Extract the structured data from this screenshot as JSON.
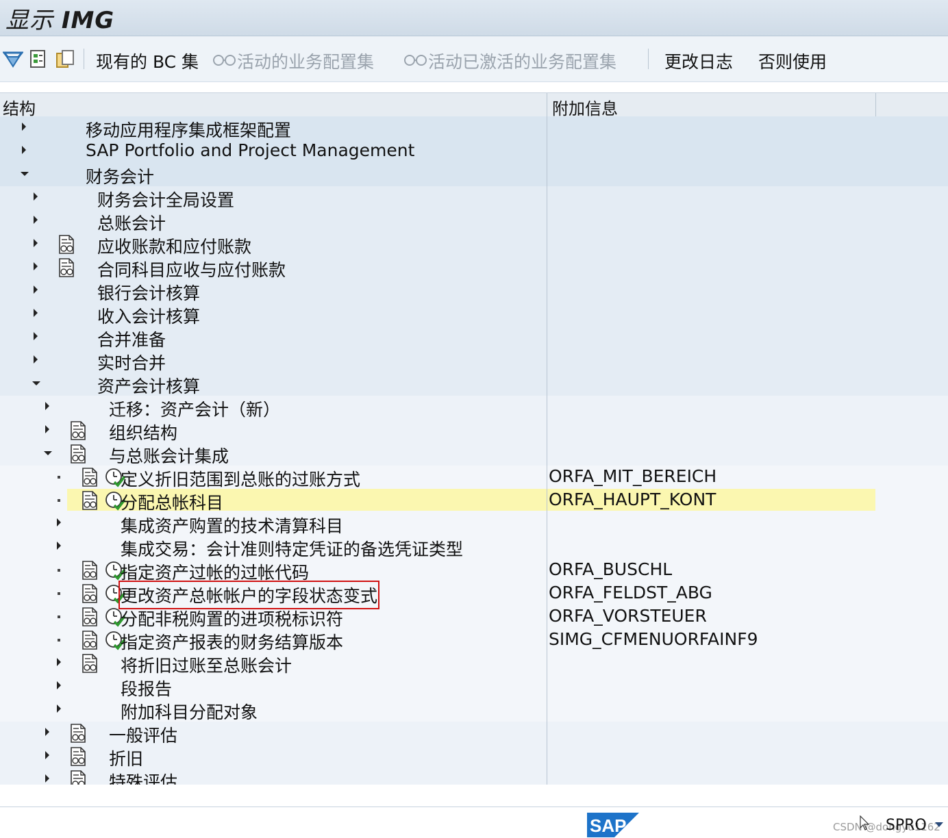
{
  "window": {
    "title_prefix": "显示 ",
    "title_bold": "IMG"
  },
  "toolbar": {
    "icons": [
      "expand-all-icon",
      "execute-icon",
      "copy-icon"
    ],
    "btn_bc": "现有的 BC 集",
    "btn_active": "活动的业务配置集",
    "btn_activated": "活动已激活的业务配置集",
    "btn_log": "更改日志",
    "btn_else": "否则使用"
  },
  "columns": {
    "structure": "结构",
    "info": "附加信息"
  },
  "tree": [
    {
      "level": 1,
      "state": "collapsed",
      "doc": false,
      "clock": false,
      "label": "移动应用程序集成框架配置",
      "info": ""
    },
    {
      "level": 1,
      "state": "collapsed",
      "doc": false,
      "clock": false,
      "label": "SAP Portfolio and Project Management",
      "info": ""
    },
    {
      "level": 1,
      "state": "expanded",
      "doc": false,
      "clock": false,
      "label": "财务会计",
      "info": ""
    },
    {
      "level": 2,
      "state": "collapsed",
      "doc": false,
      "clock": false,
      "label": "财务会计全局设置",
      "info": ""
    },
    {
      "level": 2,
      "state": "collapsed",
      "doc": false,
      "clock": false,
      "label": "总账会计",
      "info": ""
    },
    {
      "level": 2,
      "state": "collapsed",
      "doc": true,
      "clock": false,
      "label": "应收账款和应付账款",
      "info": ""
    },
    {
      "level": 2,
      "state": "collapsed",
      "doc": true,
      "clock": false,
      "label": "合同科目应收与应付账款",
      "info": ""
    },
    {
      "level": 2,
      "state": "collapsed",
      "doc": false,
      "clock": false,
      "label": "银行会计核算",
      "info": ""
    },
    {
      "level": 2,
      "state": "collapsed",
      "doc": false,
      "clock": false,
      "label": "收入会计核算",
      "info": ""
    },
    {
      "level": 2,
      "state": "collapsed",
      "doc": false,
      "clock": false,
      "label": "合并准备",
      "info": ""
    },
    {
      "level": 2,
      "state": "collapsed",
      "doc": false,
      "clock": false,
      "label": "实时合并",
      "info": ""
    },
    {
      "level": 2,
      "state": "expanded",
      "doc": false,
      "clock": false,
      "label": "资产会计核算",
      "info": ""
    },
    {
      "level": 3,
      "state": "collapsed",
      "doc": false,
      "clock": false,
      "label": "迁移：资产会计（新）",
      "info": ""
    },
    {
      "level": 3,
      "state": "collapsed",
      "doc": true,
      "clock": false,
      "label": "组织结构",
      "info": ""
    },
    {
      "level": 3,
      "state": "expanded",
      "doc": true,
      "clock": false,
      "label": "与总账会计集成",
      "info": ""
    },
    {
      "level": 4,
      "state": "leaf",
      "doc": true,
      "clock": true,
      "label": "定义折旧范围到总账的过账方式",
      "info": "ORFA_MIT_BEREICH"
    },
    {
      "level": 4,
      "state": "leaf",
      "doc": true,
      "clock": true,
      "label": "分配总帐科目",
      "info": "ORFA_HAUPT_KONT",
      "highlight": true
    },
    {
      "level": 4,
      "state": "collapsed",
      "doc": false,
      "clock": false,
      "label": "集成资产购置的技术清算科目",
      "info": ""
    },
    {
      "level": 4,
      "state": "collapsed",
      "doc": false,
      "clock": false,
      "label": "集成交易：会计准则特定凭证的备选凭证类型",
      "info": ""
    },
    {
      "level": 4,
      "state": "leaf",
      "doc": true,
      "clock": true,
      "label": "指定资产过帐的过帐代码",
      "info": "ORFA_BUSCHL"
    },
    {
      "level": 4,
      "state": "leaf",
      "doc": true,
      "clock": true,
      "label": "更改资产总帐帐户的字段状态变式",
      "info": "ORFA_FELDST_ABG",
      "boxed": true
    },
    {
      "level": 4,
      "state": "leaf",
      "doc": true,
      "clock": true,
      "label": "分配非税购置的进项税标识符",
      "info": "ORFA_VORSTEUER"
    },
    {
      "level": 4,
      "state": "leaf",
      "doc": true,
      "clock": true,
      "label": "指定资产报表的财务结算版本",
      "info": "SIMG_CFMENUORFAINF9"
    },
    {
      "level": 4,
      "state": "collapsed",
      "doc": true,
      "clock": false,
      "label": "将折旧过账至总账会计",
      "info": ""
    },
    {
      "level": 4,
      "state": "collapsed",
      "doc": false,
      "clock": false,
      "label": "段报告",
      "info": ""
    },
    {
      "level": 4,
      "state": "collapsed",
      "doc": false,
      "clock": false,
      "label": "附加科目分配对象",
      "info": ""
    },
    {
      "level": 3,
      "state": "collapsed",
      "doc": true,
      "clock": false,
      "label": "一般评估",
      "info": ""
    },
    {
      "level": 3,
      "state": "collapsed",
      "doc": true,
      "clock": false,
      "label": "折旧",
      "info": ""
    },
    {
      "level": 3,
      "state": "collapsed",
      "doc": true,
      "clock": false,
      "label": "特殊评估",
      "info": ""
    }
  ],
  "status": {
    "transaction": "SPRO",
    "watermark": "CSDN @dongyu1162"
  },
  "colors": {
    "band1": "#d9e5f0",
    "band2": "#e4ecf4",
    "band3": "#edf2f8",
    "band4": "#f3f6fa",
    "highlight": "#fbf7b0",
    "box": "#d01010"
  }
}
